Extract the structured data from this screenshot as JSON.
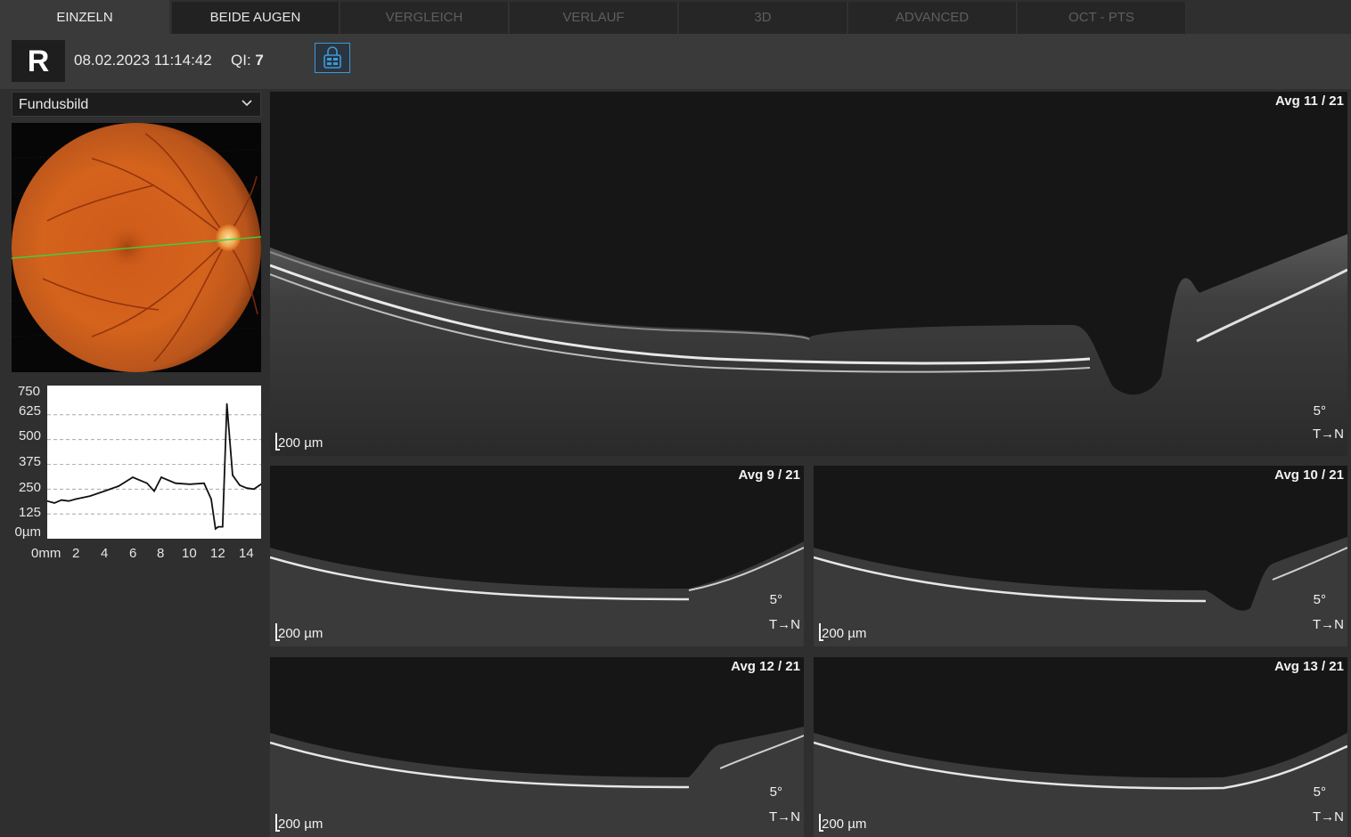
{
  "tabs": [
    {
      "label": "EINZELN",
      "state": "active"
    },
    {
      "label": "BEIDE AUGEN",
      "state": "normal"
    },
    {
      "label": "VERGLEICH",
      "state": "disabled"
    },
    {
      "label": "VERLAUF",
      "state": "disabled"
    },
    {
      "label": "3D",
      "state": "disabled"
    },
    {
      "label": "ADVANCED",
      "state": "disabled"
    },
    {
      "label": "OCT - PTS",
      "state": "disabled"
    }
  ],
  "header": {
    "eye": "R",
    "datetime": "08.02.2023 11:14:42",
    "qi_label": "QI:",
    "qi_value": "7",
    "lock_icon": "lock-grid-icon"
  },
  "left_panel": {
    "view_select": "Fundusbild",
    "thickness_plot": {
      "y_ticks": [
        "750",
        "625",
        "500",
        "375",
        "250",
        "125",
        "0µm"
      ],
      "x_ticks": [
        "0mm",
        "2",
        "4",
        "6",
        "8",
        "10",
        "12",
        "14"
      ]
    }
  },
  "chart_data": {
    "type": "line",
    "xlabel": "mm",
    "ylabel": "µm",
    "ylim": [
      0,
      750
    ],
    "xlim": [
      0,
      15
    ],
    "grid": true,
    "x": [
      0,
      0.5,
      1,
      1.5,
      2,
      3,
      4,
      5,
      6,
      7,
      7.5,
      8,
      9,
      10,
      11,
      11.5,
      11.8,
      12,
      12.3,
      12.6,
      13,
      13.5,
      14,
      14.5,
      15
    ],
    "values": [
      190,
      180,
      195,
      190,
      200,
      215,
      240,
      265,
      310,
      280,
      240,
      310,
      280,
      275,
      280,
      200,
      50,
      60,
      60,
      680,
      320,
      270,
      255,
      250,
      275
    ]
  },
  "scans": {
    "main": {
      "avg": "Avg 11 / 21",
      "scale": "200 µm",
      "angle": "5°",
      "direction": "T→N"
    },
    "tiles": [
      {
        "avg": "Avg 9 / 21",
        "scale": "200 µm",
        "angle": "5°",
        "direction": "T→N"
      },
      {
        "avg": "Avg 10 / 21",
        "scale": "200 µm",
        "angle": "5°",
        "direction": "T→N"
      },
      {
        "avg": "Avg 12 / 21",
        "scale": "200 µm",
        "angle": "5°",
        "direction": "T→N"
      },
      {
        "avg": "Avg 13 / 21",
        "scale": "200 µm",
        "angle": "5°",
        "direction": "T→N"
      }
    ]
  },
  "colors": {
    "accent": "#3a9ad9",
    "fundus": "#c8541c",
    "scan_line": "#3fcf3f"
  }
}
